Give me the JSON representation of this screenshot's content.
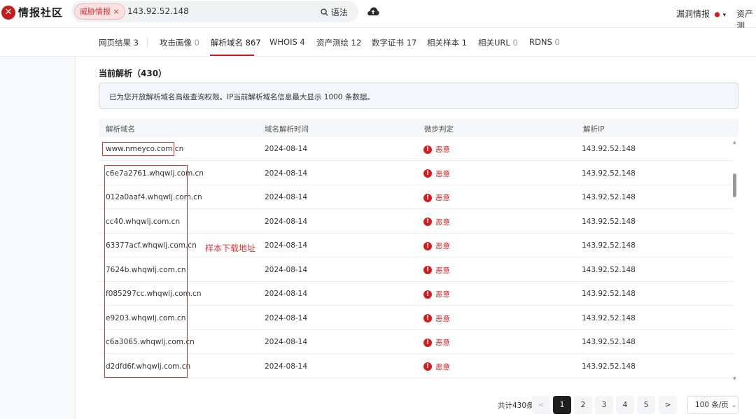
{
  "header": {
    "logo_glyph": "✕",
    "logo_text": "情报社区",
    "search_tag": "威胁情报 ×",
    "search_value": "143.92.52.148",
    "syntax_icon": "search-icon",
    "syntax_label": "语法",
    "vuln_intel": "漏洞情报",
    "vuln_intel_caret": "▾",
    "asset": "资产测"
  },
  "tabs": [
    {
      "label": "网页结果",
      "count": "3"
    },
    {
      "label": "攻击画像",
      "count": "0"
    },
    {
      "label": "解析域名",
      "count": "867",
      "active": true
    },
    {
      "label": "WHOIS",
      "count": "4"
    },
    {
      "label": "资产测绘",
      "count": "12"
    },
    {
      "label": "数字证书",
      "count": "17"
    },
    {
      "label": "相关样本",
      "count": "1"
    },
    {
      "label": "相关URL",
      "count": "0"
    },
    {
      "label": "RDNS",
      "count": "0"
    }
  ],
  "section_title": "当前解析（430）",
  "notice": "已为您开放解析域名高级查询权限。IP当前解析域名信息最大显示 1000 条数据。",
  "table": {
    "columns": [
      "解析域名",
      "域名解析时间",
      "微步判定",
      "解析IP"
    ],
    "rows": [
      {
        "domain": "www.nmeyco.com.cn",
        "date": "2024-08-14",
        "verdict": "恶意",
        "ip": "143.92.52.148"
      },
      {
        "domain": "c6e7a2761.whqwlj.com.cn",
        "date": "2024-08-14",
        "verdict": "恶意",
        "ip": "143.92.52.148"
      },
      {
        "domain": "012a0aaf4.whqwlj.com.cn",
        "date": "2024-08-14",
        "verdict": "恶意",
        "ip": "143.92.52.148"
      },
      {
        "domain": "cc40.whqwlj.com.cn",
        "date": "2024-08-14",
        "verdict": "恶意",
        "ip": "143.92.52.148"
      },
      {
        "domain": "63377acf.whqwlj.com.cn",
        "date": "2024-08-14",
        "verdict": "恶意",
        "ip": "143.92.52.148"
      },
      {
        "domain": "7624b.whqwlj.com.cn",
        "date": "2024-08-14",
        "verdict": "恶意",
        "ip": "143.92.52.148"
      },
      {
        "domain": "f085297cc.whqwlj.com.cn",
        "date": "2024-08-14",
        "verdict": "恶意",
        "ip": "143.92.52.148"
      },
      {
        "domain": "e9203.whqwlj.com.cn",
        "date": "2024-08-14",
        "verdict": "恶意",
        "ip": "143.92.52.148"
      },
      {
        "domain": "c6a3065.whqwlj.com.cn",
        "date": "2024-08-14",
        "verdict": "恶意",
        "ip": "143.92.52.148"
      },
      {
        "domain": "d2dfd6f.whqwlj.com.cn",
        "date": "2024-08-14",
        "verdict": "恶意",
        "ip": "143.92.52.148"
      }
    ],
    "verdict_icon_glyph": "!"
  },
  "annotation": "样本下载地址",
  "scrollbar": {
    "up_glyph": "▲",
    "down_glyph": "▼"
  },
  "pagination": {
    "total": "共计430条",
    "prev": "<",
    "pages": [
      "1",
      "2",
      "3",
      "4",
      "5"
    ],
    "current": "1",
    "next": ">",
    "page_size": "100 条/页",
    "page_size_caret": "⌄"
  },
  "colors": {
    "accent": "#c41c1c",
    "malicious": "#d41e1e",
    "annotation": "#e03333"
  }
}
